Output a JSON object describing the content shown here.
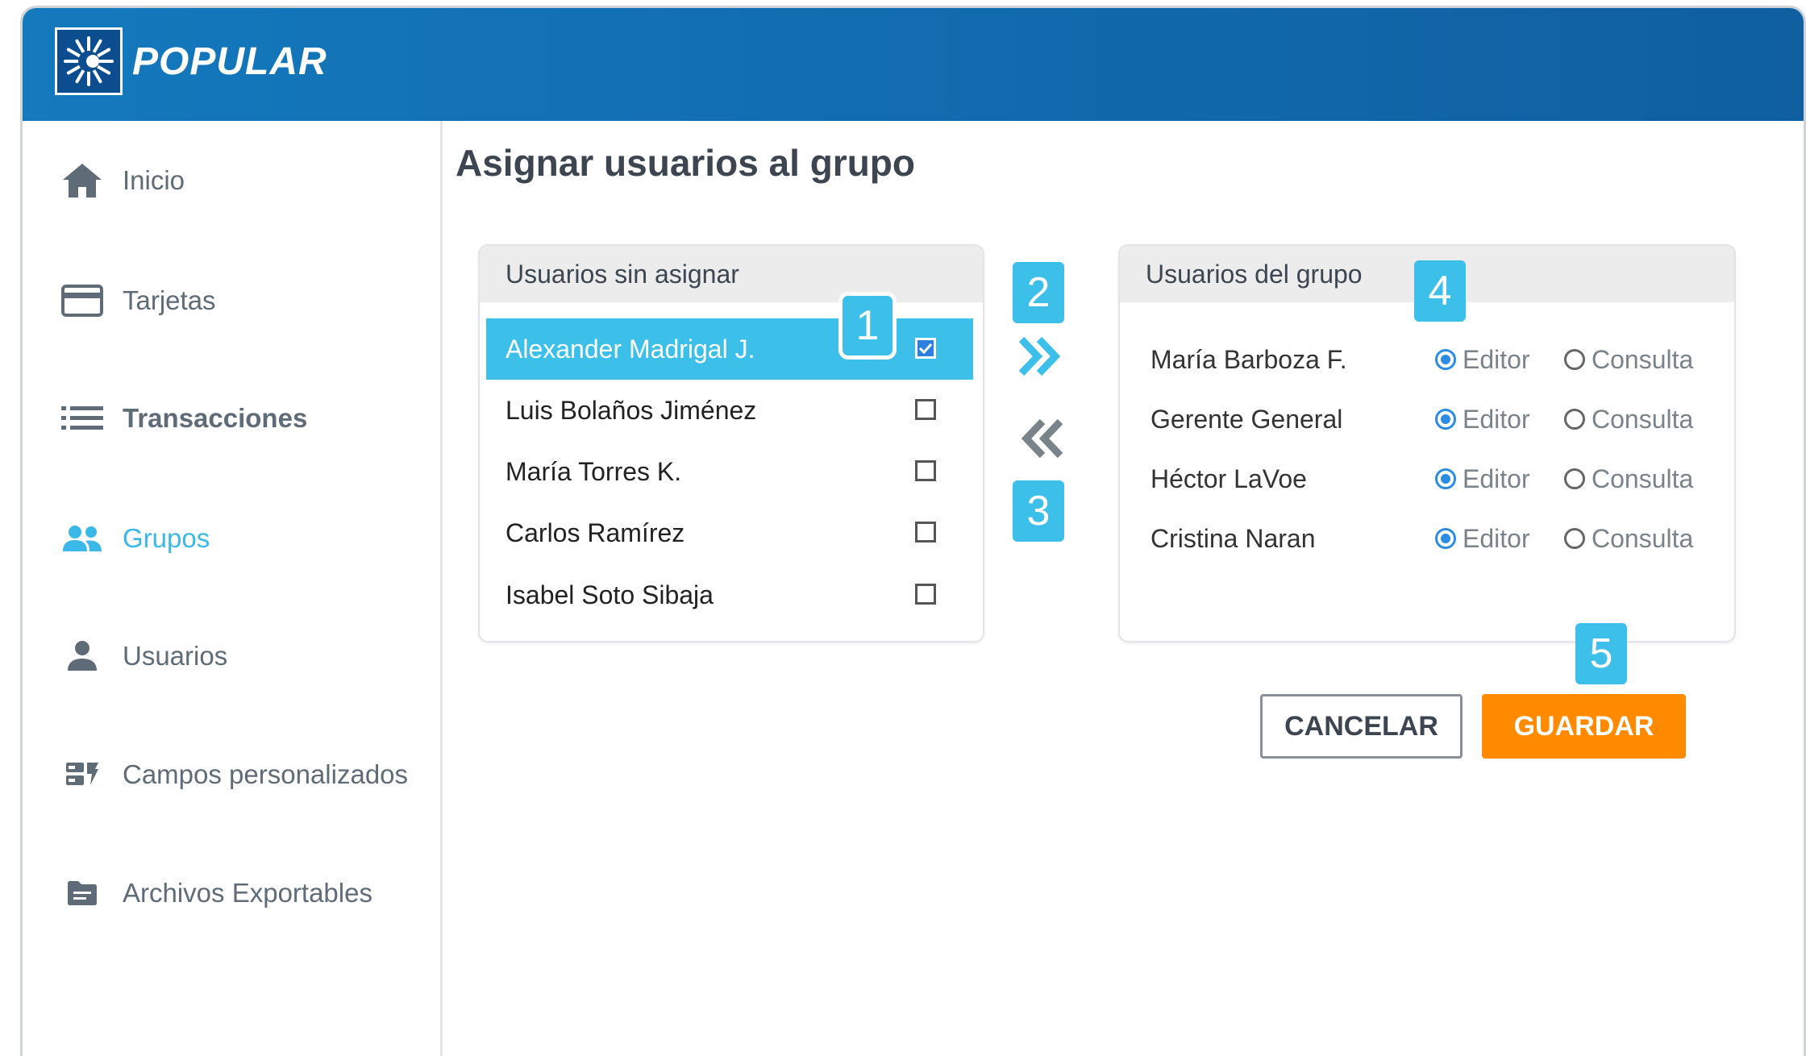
{
  "brand": {
    "name": "POPULAR",
    "logo_icon": "sun-rays-icon"
  },
  "sidebar": {
    "items": [
      {
        "label": "Inicio",
        "icon": "home-icon",
        "active": false
      },
      {
        "label": "Tarjetas",
        "icon": "credit-card-icon",
        "active": false
      },
      {
        "label": "Transacciones",
        "icon": "list-icon",
        "active": false
      },
      {
        "label": "Grupos",
        "icon": "group-icon",
        "active": true
      },
      {
        "label": "Usuarios",
        "icon": "person-icon",
        "active": false
      },
      {
        "label": "Campos personalizados",
        "icon": "custom-fields-icon",
        "active": false
      },
      {
        "label": "Archivos Exportables",
        "icon": "folder-icon",
        "active": false
      }
    ]
  },
  "main": {
    "title": "Asignar usuarios al grupo",
    "unassigned": {
      "header": "Usuarios sin asignar",
      "users": [
        {
          "name": "Alexander Madrigal J.",
          "checked": true
        },
        {
          "name": "Luis Bolaños Jiménez",
          "checked": false
        },
        {
          "name": "María Torres K.",
          "checked": false
        },
        {
          "name": "Carlos Ramírez",
          "checked": false
        },
        {
          "name": "Isabel Soto Sibaja",
          "checked": false
        }
      ]
    },
    "group": {
      "header": "Usuarios del grupo",
      "editor_label": "Editor",
      "consulta_label": "Consulta",
      "members": [
        {
          "name": "María Barboza F.",
          "role": "Editor"
        },
        {
          "name": "Gerente General",
          "role": "Editor"
        },
        {
          "name": "Héctor LaVoe",
          "role": "Editor"
        },
        {
          "name": "Cristina Naran",
          "role": "Editor"
        }
      ]
    },
    "badges": [
      "1",
      "2",
      "3",
      "4",
      "5"
    ],
    "buttons": {
      "cancel": "CANCELAR",
      "save": "GUARDAR"
    }
  },
  "colors": {
    "accent": "#3cbfe9",
    "header": "#1479bd",
    "save": "#ff8a00",
    "radio": "#2b8ce3"
  }
}
